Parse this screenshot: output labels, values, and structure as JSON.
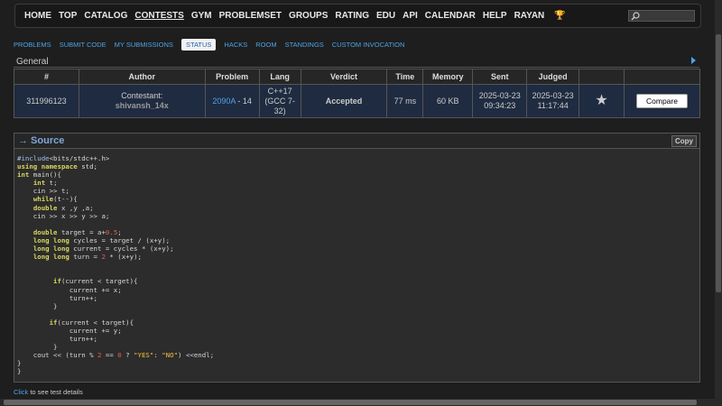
{
  "nav": {
    "items": [
      "HOME",
      "TOP",
      "CATALOG",
      "CONTESTS",
      "GYM",
      "PROBLEMSET",
      "GROUPS",
      "RATING",
      "EDU",
      "API",
      "CALENDAR",
      "HELP"
    ],
    "active": "CONTESTS",
    "user": "RAYAN",
    "user_icon": "trophy-icon"
  },
  "subnav": {
    "items": [
      "PROBLEMS",
      "SUBMIT CODE",
      "MY SUBMISSIONS",
      "STATUS",
      "HACKS",
      "ROOM",
      "STANDINGS",
      "CUSTOM INVOCATION"
    ],
    "active": "STATUS"
  },
  "general": {
    "title": "General",
    "headers": [
      "#",
      "Author",
      "Problem",
      "Lang",
      "Verdict",
      "Time",
      "Memory",
      "Sent",
      "Judged",
      "",
      ""
    ],
    "row": {
      "id": "311996123",
      "author_label": "Contestant:",
      "author_name": "shivansh_14x",
      "problem_link": "2090A",
      "problem_suffix": " - 14",
      "lang": "C++17 (GCC 7-32)",
      "verdict": "Accepted",
      "time": "77 ms",
      "memory": "60 KB",
      "sent": "2025-03-23 09:34:23",
      "judged": "2025-03-23 11:17:44",
      "compare": "Compare"
    }
  },
  "source": {
    "title": "→ Source",
    "copy": "Copy"
  },
  "footer": {
    "link": "Click",
    "text": " to see test details"
  },
  "colors": {
    "accent": "#4ea3e6",
    "verdict_ok": "#3bb33b",
    "row_bg": "#1f2b40"
  }
}
